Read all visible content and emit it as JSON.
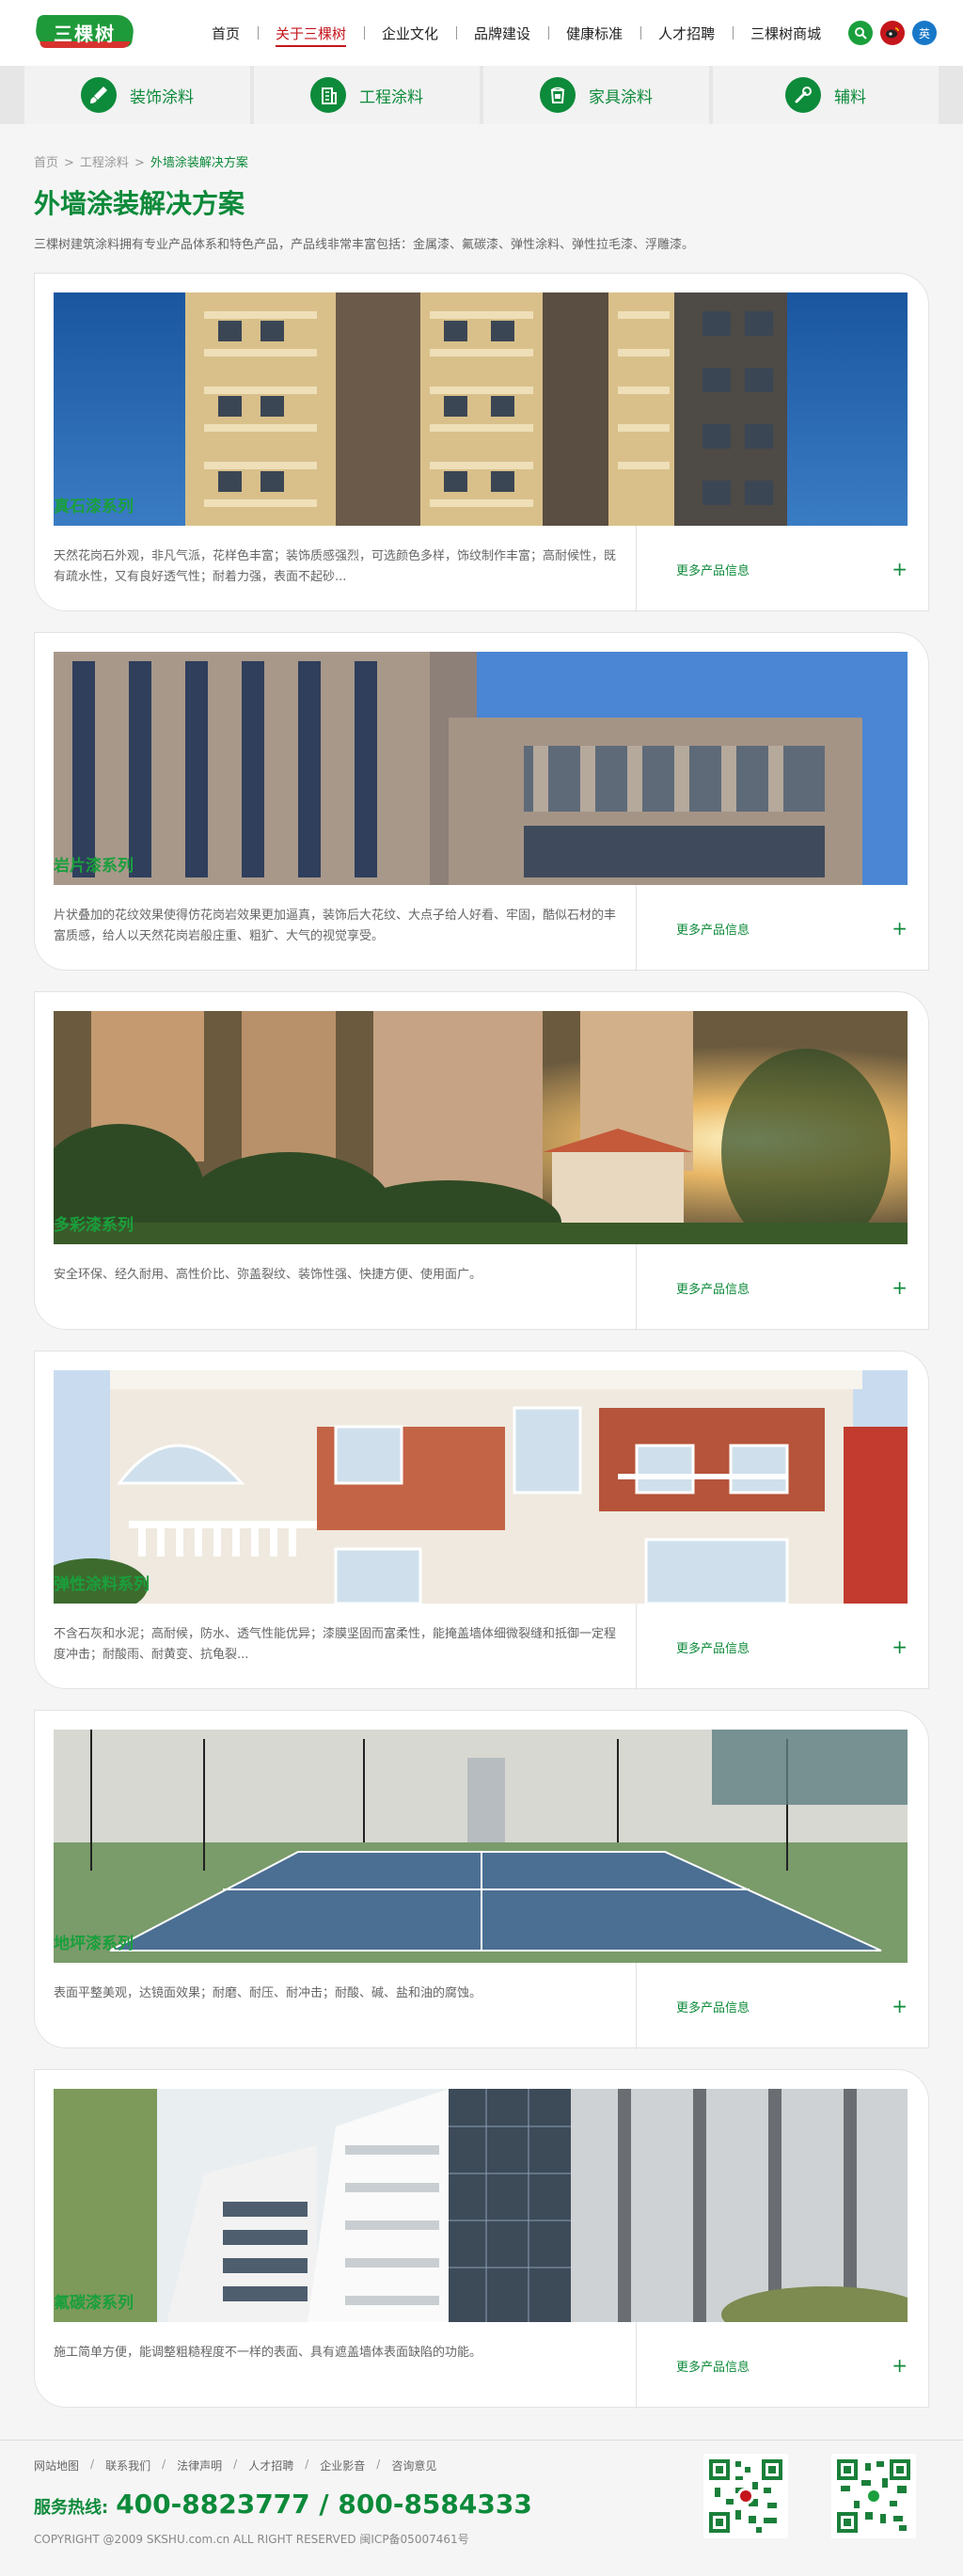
{
  "header": {
    "logo_text": "三棵树",
    "nav": [
      "首页",
      "关于三棵树",
      "企业文化",
      "品牌建设",
      "健康标准",
      "人才招聘",
      "三棵树商城"
    ],
    "lang_label": "英"
  },
  "categories": [
    {
      "label": "装饰涂料",
      "icon": "paint-brush-icon"
    },
    {
      "label": "工程涂料",
      "icon": "building-icon"
    },
    {
      "label": "家具涂料",
      "icon": "paint-bucket-icon"
    },
    {
      "label": "辅料",
      "icon": "tools-icon"
    }
  ],
  "breadcrumb": {
    "home": "首页",
    "level2": "工程涂料",
    "current": "外墙涂装解决方案",
    "sep": ">"
  },
  "page": {
    "title": "外墙涂装解决方案",
    "description": "三棵树建筑涂料拥有专业产品体系和特色产品，产品线非常丰富包括：金属漆、氟碳漆、弹性涂料、弹性拉毛漆、浮雕漆。"
  },
  "cards": [
    {
      "series": "真石漆系列",
      "desc": "天然花岗石外观，非凡气派，花样色丰富；装饰质感强烈，可选颜色多样，饰纹制作丰富；高耐候性，既有疏水性，又有良好透气性；耐着力强，表面不起砂...",
      "more": "更多产品信息"
    },
    {
      "series": "岩片漆系列",
      "desc": "片状叠加的花纹效果使得仿花岗岩效果更加逼真，装饰后大花纹、大点子给人好看、牢固，酷似石材的丰富质感，给人以天然花岗岩般庄重、粗犷、大气的视觉享受。",
      "more": "更多产品信息"
    },
    {
      "series": "多彩漆系列",
      "desc": "安全环保、经久耐用、高性价比、弥盖裂纹、装饰性强、快捷方便、使用面广。",
      "more": "更多产品信息"
    },
    {
      "series": "弹性涂料系列",
      "desc": "不含石灰和水泥；高耐候，防水、透气性能优异；漆膜坚固而富柔性，能掩盖墙体细微裂缝和抵御一定程度冲击；耐酸雨、耐黄变、抗龟裂...",
      "more": "更多产品信息"
    },
    {
      "series": "地坪漆系列",
      "desc": "表面平整美观，达镜面效果；耐磨、耐压、耐冲击；耐酸、碱、盐和油的腐蚀。",
      "more": "更多产品信息"
    },
    {
      "series": "氟碳漆系列",
      "desc": "施工简单方便，能调整粗糙程度不一样的表面、具有遮盖墙体表面缺陷的功能。",
      "more": "更多产品信息"
    }
  ],
  "footer": {
    "links": [
      "网站地图",
      "联系我们",
      "法律声明",
      "人才招聘",
      "企业影音",
      "咨询意见"
    ],
    "hotline_label": "服务热线:",
    "hotline_numbers": "400-8823777 / 800-8584333",
    "copyright": "COPYRIGHT @2009 SKSHU.com.cn ALL RIGHT RESERVED 闽ICP备05007461号"
  },
  "colors": {
    "brand_green": "#0d8a3a",
    "accent_red": "#c4161c"
  }
}
